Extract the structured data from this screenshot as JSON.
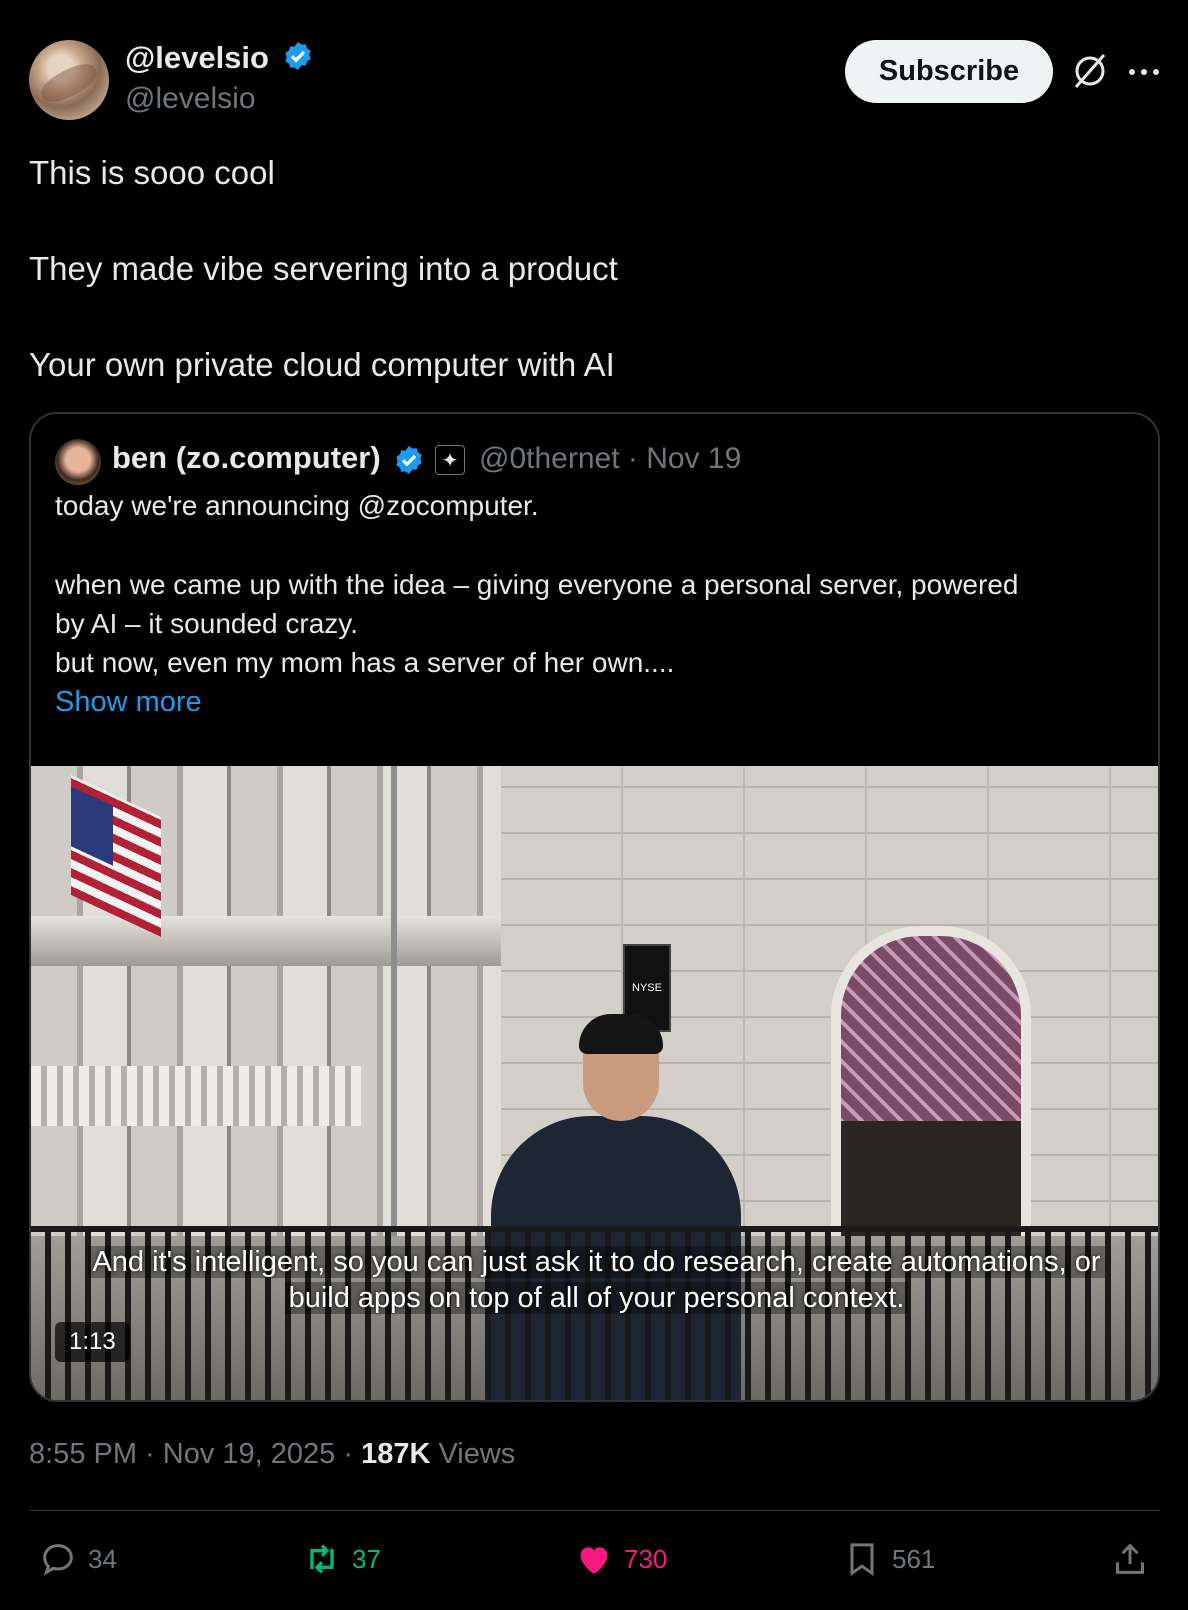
{
  "author": {
    "display_name": "@levelsio",
    "handle": "@levelsio",
    "verified": true
  },
  "header": {
    "subscribe_label": "Subscribe"
  },
  "tweet": {
    "lines": [
      "This is sooo cool",
      "They made vibe servering into a product",
      "Your own private cloud computer with AI"
    ]
  },
  "quote": {
    "name": "ben (zo.computer)",
    "handle_date": "@0thernet · Nov 19",
    "lines": [
      "today we're announcing @zocomputer.",
      "when we came up with the idea – giving everyone a personal server, powered",
      "by AI – it sounded crazy.",
      "but now, even my mom has a server of her own...."
    ],
    "show_more": "Show more",
    "video": {
      "caption_line1": "And it's intelligent, so you can just ask it to do research, create automations, or",
      "caption_line2": "build apps on top of all of your personal context.",
      "duration": "1:13",
      "sign_text": "NYSE"
    }
  },
  "meta": {
    "time_date": "8:55 PM · Nov 19, 2025 · ",
    "views_count": "187K",
    "views_label": " Views"
  },
  "actions": {
    "replies": "34",
    "reposts": "37",
    "likes": "730",
    "bookmarks": "561"
  },
  "colors": {
    "accent": "#1d9bf0",
    "repost": "#00ba7c",
    "like": "#f91880",
    "muted": "#71767b"
  }
}
